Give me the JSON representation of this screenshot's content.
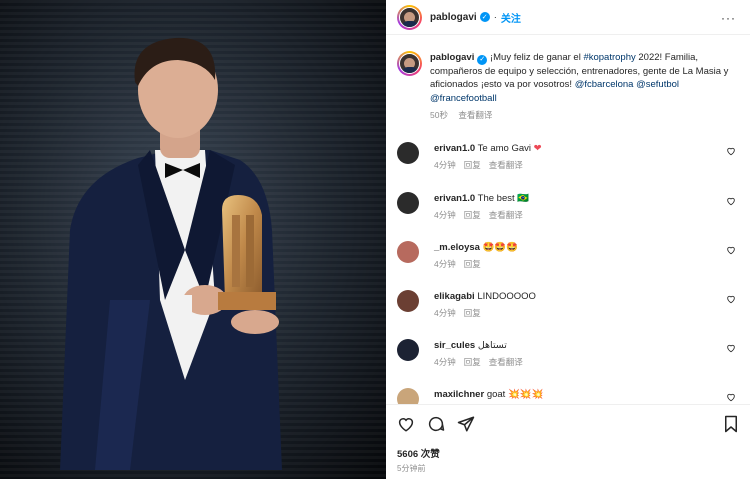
{
  "header": {
    "username": "pablogavi",
    "follow_label": "关注",
    "more_label": "···"
  },
  "caption": {
    "username": "pablogavi",
    "text_1": "¡Muy feliz de ganar el ",
    "hashtag": "#kopatrophy",
    "text_2": " 2022! Familia, compañeros de equipo y selección, entrenadores, gente de La Masia y aficionados ¡esto va por vosotros! ",
    "mention_1": "@fcbarcelona",
    "mention_2": "@sefutbol",
    "mention_3": "@francefootball",
    "age": "50秒",
    "translate": "查看翻译"
  },
  "comments": [
    {
      "username": "erivan1.0",
      "text": "Te amo Gavi ",
      "emoji": "❤",
      "age": "4分钟",
      "reply": "回复",
      "translate": "查看翻译",
      "avatar_color": "#2b2b2b"
    },
    {
      "username": "erivan1.0",
      "text": "The best ",
      "emoji": "🇧🇷",
      "age": "4分钟",
      "reply": "回复",
      "translate": "查看翻译",
      "avatar_color": "#2b2b2b"
    },
    {
      "username": "_m.eloysa",
      "text": "",
      "emoji": "🤩🤩🤩",
      "age": "4分钟",
      "reply": "回复",
      "translate": "",
      "avatar_color": "#b76a5e"
    },
    {
      "username": "elikagabi",
      "text": "LINDOOOOO",
      "emoji": "",
      "age": "4分钟",
      "reply": "回复",
      "translate": "",
      "avatar_color": "#6b3f33"
    },
    {
      "username": "sir_cules",
      "text": "تستاهل",
      "emoji": "",
      "age": "4分钟",
      "reply": "回复",
      "translate": "查看翻译",
      "avatar_color": "#1c2233"
    },
    {
      "username": "maxilchner",
      "text": "goat ",
      "emoji": "💥💥💥",
      "age": "",
      "reply": "",
      "translate": "",
      "avatar_color": "#c9a57a"
    }
  ],
  "footer": {
    "likes": "5606 次赞",
    "time": "5分钟前"
  },
  "colors": {
    "accent": "#0095f6",
    "link": "#00376b",
    "heart_red": "#ed4956",
    "muted": "#8e8e8e"
  },
  "icons": [
    "verified-icon",
    "more-icon",
    "like-icon",
    "comment-icon",
    "share-icon",
    "save-icon",
    "comment-like-icon"
  ]
}
